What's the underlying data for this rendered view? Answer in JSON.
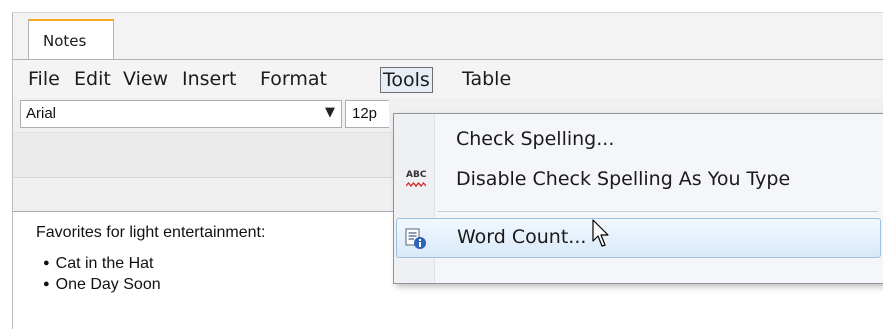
{
  "tabs": [
    {
      "label": "Notes"
    }
  ],
  "menubar": {
    "items": [
      {
        "label": "File"
      },
      {
        "label": "Edit"
      },
      {
        "label": "View"
      },
      {
        "label": "Insert"
      },
      {
        "label": "Format"
      },
      {
        "label": "Tools"
      },
      {
        "label": "Table"
      }
    ]
  },
  "toolbar": {
    "font_family": "Arial",
    "font_size": "12p",
    "font_dropdown_icon": "chevron-down-icon"
  },
  "tools_menu": {
    "items": [
      {
        "label": "Check Spelling...",
        "icon": ""
      },
      {
        "label": "Disable Check Spelling As You Type",
        "icon": "abc-spellcheck-icon",
        "icon_text": "ABC"
      },
      {
        "label": "Word Count...",
        "icon": "word-count-icon",
        "highlighted": true
      }
    ]
  },
  "editor": {
    "heading": "Favorites for light entertainment:",
    "list": [
      "Cat in the Hat",
      "One Day Soon"
    ]
  },
  "colors": {
    "tab_accent": "#f4a623",
    "menu_highlight": "#d9e9f9",
    "spell_squiggle": "#d42020"
  }
}
